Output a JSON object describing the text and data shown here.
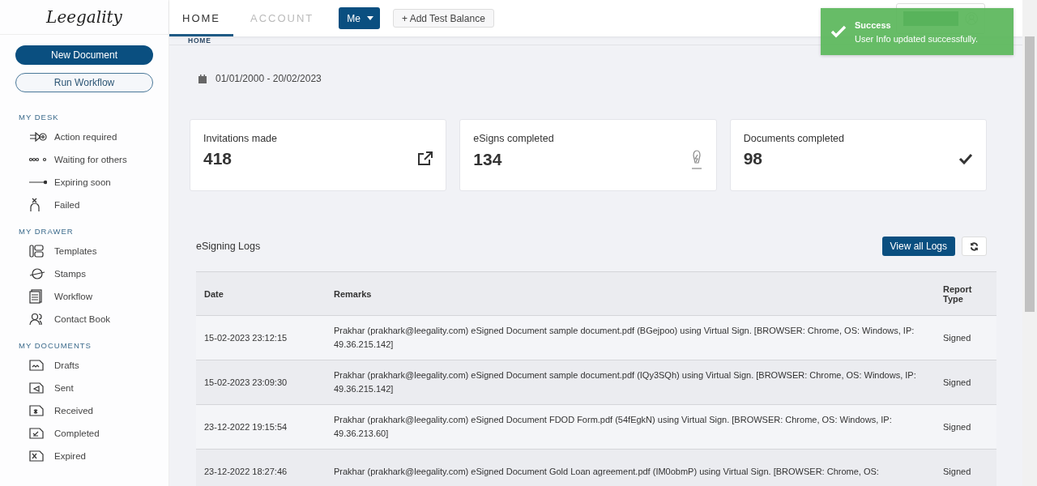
{
  "sidebar": {
    "logo": "Leegality",
    "buttons": [
      {
        "label": "New Document",
        "kind": "primary"
      },
      {
        "label": "Run Workflow",
        "kind": "outline"
      }
    ],
    "sections": [
      {
        "title": "MY DESK",
        "items": [
          {
            "label": "Action required",
            "kind": "action"
          },
          {
            "label": "Waiting for others",
            "kind": "waiting"
          },
          {
            "label": "Expiring soon",
            "kind": "expiring"
          },
          {
            "label": "Failed",
            "kind": "failed"
          }
        ]
      },
      {
        "title": "MY DRAWER",
        "items": [
          {
            "label": "Templates",
            "kind": "templates"
          },
          {
            "label": "Stamps",
            "kind": "stamps"
          },
          {
            "label": "Workflow",
            "kind": "workflow"
          },
          {
            "label": "Contact Book",
            "kind": "contacts"
          }
        ]
      },
      {
        "title": "MY DOCUMENTS",
        "items": [
          {
            "label": "Drafts",
            "kind": "drafts"
          },
          {
            "label": "Sent",
            "kind": "sent"
          },
          {
            "label": "Received",
            "kind": "received"
          },
          {
            "label": "Completed",
            "kind": "completed"
          },
          {
            "label": "Expired",
            "kind": "expired"
          }
        ]
      }
    ]
  },
  "tabs": [
    {
      "label": "HOME",
      "selected": true
    },
    {
      "label": "ACCOUNT",
      "selected": false
    }
  ],
  "user_menu": {
    "label": "Me"
  },
  "add_balance": {
    "label": "+ Add Test Balance"
  },
  "breadcrumb": "HOME",
  "date_range": "01/01/2000 - 20/02/2023",
  "stats": [
    {
      "label": "Invitations made",
      "value": "418",
      "kind": "external"
    },
    {
      "label": "eSigns completed",
      "value": "134",
      "kind": "pen"
    },
    {
      "label": "Documents completed",
      "value": "98",
      "kind": "check"
    }
  ],
  "logs": {
    "title": "eSigning Logs",
    "view_all": "View all Logs",
    "columns": [
      "Date",
      "Remarks",
      "Report Type"
    ],
    "rows": [
      {
        "date": "15-02-2023 23:12:15",
        "remarks": "Prakhar (prakhark@leegality.com) eSigned Document sample document.pdf (BGejpoo) using Virtual Sign. [BROWSER: Chrome, OS: Windows, IP: 49.36.215.142]",
        "type": "Signed"
      },
      {
        "date": "15-02-2023 23:09:30",
        "remarks": "Prakhar (prakhark@leegality.com) eSigned Document sample document.pdf (IQy3SQh) using Virtual Sign. [BROWSER: Chrome, OS: Windows, IP: 49.36.215.142]",
        "type": "Signed"
      },
      {
        "date": "23-12-2022 19:15:54",
        "remarks": "Prakhar (prakhark@leegality.com) eSigned Document FDOD Form.pdf (54fEgkN) using Virtual Sign. [BROWSER: Chrome, OS: Windows, IP: 49.36.213.60]",
        "type": "Signed"
      },
      {
        "date": "23-12-2022 18:27:46",
        "remarks": "Prakhar (prakhark@leegality.com) eSigned Document Gold Loan agreement.pdf (IM0obmP) using Virtual Sign. [BROWSER: Chrome, OS:",
        "type": "Signed"
      }
    ]
  },
  "toast": {
    "title": "Success",
    "message": "User Info updated successfully."
  }
}
